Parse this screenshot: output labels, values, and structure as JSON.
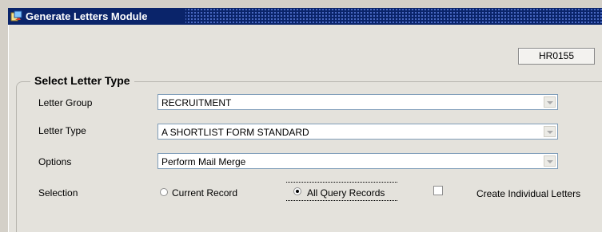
{
  "window": {
    "title": "Generate Letters Module",
    "icon": "app-icon",
    "form_code": "HR0155"
  },
  "group": {
    "title": "Select Letter Type"
  },
  "fields": {
    "letter_group": {
      "label": "Letter Group",
      "value": "RECRUITMENT"
    },
    "letter_type": {
      "label": "Letter Type",
      "value": "A SHORTLIST FORM STANDARD"
    },
    "options": {
      "label": "Options",
      "value": "Perform Mail Merge"
    }
  },
  "selection": {
    "label": "Selection",
    "options": [
      {
        "label": "Current Record",
        "checked": false
      },
      {
        "label": "All Query Records",
        "checked": true
      }
    ],
    "create_individual": {
      "label": "Create Individual Letters",
      "checked": false
    }
  },
  "colors": {
    "title_bar": "#0a246a",
    "window_bg": "#e4e2dc",
    "combo_border": "#7f9db9"
  }
}
